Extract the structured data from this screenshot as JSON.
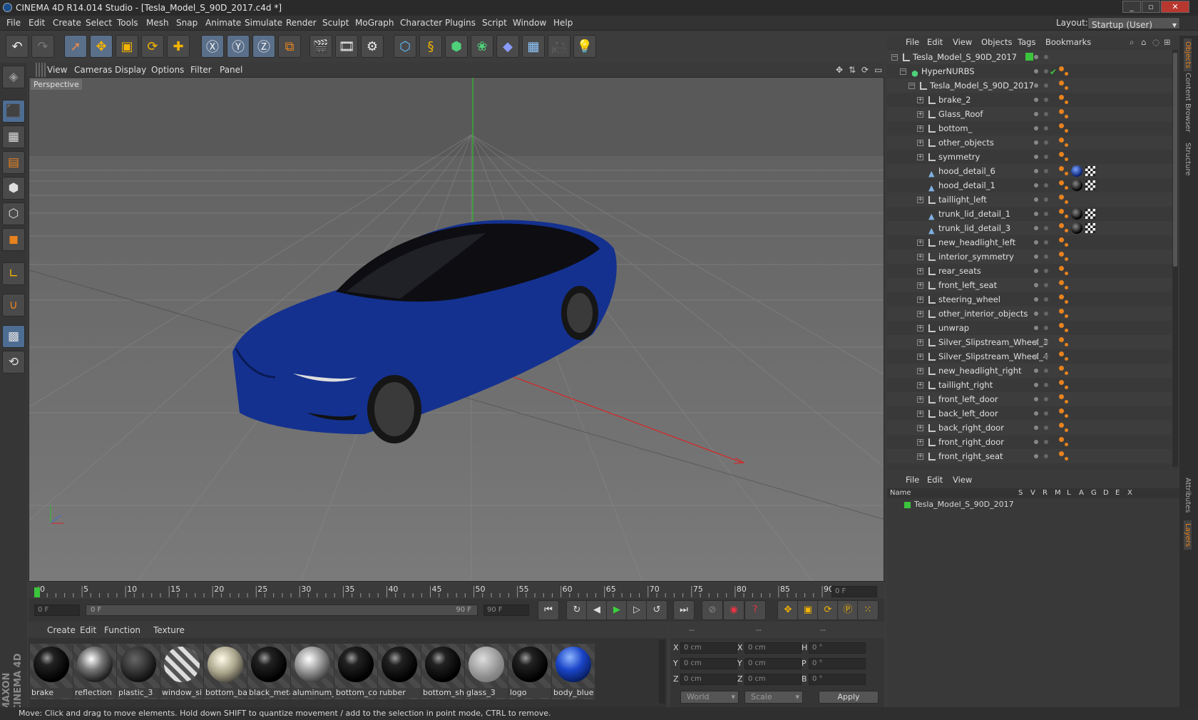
{
  "window": {
    "title": "CINEMA 4D R14.014 Studio - [Tesla_Model_S_90D_2017.c4d *]",
    "layout_label": "Layout:",
    "layout_value": "Startup (User)"
  },
  "menu": [
    "File",
    "Edit",
    "Create",
    "Select",
    "Tools",
    "Mesh",
    "Snap",
    "Animate",
    "Simulate",
    "Render",
    "Sculpt",
    "MoGraph",
    "Character",
    "Plugins",
    "Script",
    "Window",
    "Help"
  ],
  "viewport": {
    "menu": [
      "View",
      "Cameras",
      "Display",
      "Options",
      "Filter",
      "Panel"
    ],
    "label": "Perspective"
  },
  "objects": {
    "menu": [
      "File",
      "Edit",
      "View",
      "Objects",
      "Tags",
      "Bookmarks"
    ],
    "rows": [
      {
        "name": "Tesla_Model_S_90D_2017",
        "indent": 0,
        "type": "null"
      },
      {
        "name": "HyperNURBS",
        "indent": 1,
        "type": "nurbs"
      },
      {
        "name": "Tesla_Model_S_90D_2017",
        "indent": 2,
        "type": "null"
      },
      {
        "name": "brake_2",
        "indent": 3,
        "type": "null"
      },
      {
        "name": "Glass_Roof",
        "indent": 3,
        "type": "null"
      },
      {
        "name": "bottom_",
        "indent": 3,
        "type": "null"
      },
      {
        "name": "other_objects",
        "indent": 3,
        "type": "null"
      },
      {
        "name": "symmetry",
        "indent": 3,
        "type": "null"
      },
      {
        "name": "hood_detail_6",
        "indent": 3,
        "type": "poly",
        "mat": "blue"
      },
      {
        "name": "hood_detail_1",
        "indent": 3,
        "type": "poly",
        "mat": "black"
      },
      {
        "name": "taillight_left",
        "indent": 3,
        "type": "null"
      },
      {
        "name": "trunk_lid_detail_1",
        "indent": 3,
        "type": "poly",
        "mat": "black"
      },
      {
        "name": "trunk_lid_detail_3",
        "indent": 3,
        "type": "poly",
        "mat": "black"
      },
      {
        "name": "new_headlight_left",
        "indent": 3,
        "type": "null"
      },
      {
        "name": "interior_symmetry",
        "indent": 3,
        "type": "null"
      },
      {
        "name": "rear_seats",
        "indent": 3,
        "type": "null"
      },
      {
        "name": "front_left_seat",
        "indent": 3,
        "type": "null"
      },
      {
        "name": "steering_wheel",
        "indent": 3,
        "type": "null"
      },
      {
        "name": "other_interior_objects",
        "indent": 3,
        "type": "null"
      },
      {
        "name": "unwrap",
        "indent": 3,
        "type": "null"
      },
      {
        "name": "Silver_Slipstream_Wheel_3",
        "indent": 3,
        "type": "null"
      },
      {
        "name": "Silver_Slipstream_Wheel_4",
        "indent": 3,
        "type": "null"
      },
      {
        "name": "new_headlight_right",
        "indent": 3,
        "type": "null"
      },
      {
        "name": "taillight_right",
        "indent": 3,
        "type": "null"
      },
      {
        "name": "front_left_door",
        "indent": 3,
        "type": "null"
      },
      {
        "name": "back_left_door",
        "indent": 3,
        "type": "null"
      },
      {
        "name": "back_right_door",
        "indent": 3,
        "type": "null"
      },
      {
        "name": "front_right_door",
        "indent": 3,
        "type": "null"
      },
      {
        "name": "front_right_seat",
        "indent": 3,
        "type": "null"
      }
    ]
  },
  "layers": {
    "menu": [
      "File",
      "Edit",
      "View"
    ],
    "name_header": "Name",
    "cols": [
      "S",
      "V",
      "R",
      "M",
      "L",
      "A",
      "G",
      "D",
      "E",
      "X"
    ],
    "row": "Tesla_Model_S_90D_2017"
  },
  "right_tabs": [
    "Objects",
    "Content Browser",
    "Structure",
    "Attributes",
    "Layers"
  ],
  "timeline": {
    "ticks": [
      "0",
      "5",
      "10",
      "15",
      "20",
      "25",
      "30",
      "35",
      "40",
      "45",
      "50",
      "55",
      "60",
      "65",
      "70",
      "75",
      "80",
      "85",
      "90"
    ],
    "frame_field": "0 F",
    "current": "0 F",
    "range_start": "0 F",
    "range_end": "90 F",
    "end_field": "90 F"
  },
  "materials": {
    "menu": [
      "Create",
      "Edit",
      "Function",
      "Texture"
    ],
    "items": [
      {
        "name": "brake",
        "style": "black"
      },
      {
        "name": "reflection",
        "style": "chrome"
      },
      {
        "name": "plastic_3",
        "style": "darkgray"
      },
      {
        "name": "window_si",
        "style": "stripe"
      },
      {
        "name": "bottom_ba",
        "style": "ivory"
      },
      {
        "name": "black_meta",
        "style": "black"
      },
      {
        "name": "aluminum_",
        "style": "silver"
      },
      {
        "name": "bottom_co",
        "style": "black"
      },
      {
        "name": "rubber",
        "style": "black"
      },
      {
        "name": "bottom_sh",
        "style": "black"
      },
      {
        "name": "glass_3",
        "style": "glass"
      },
      {
        "name": "logo",
        "style": "black"
      },
      {
        "name": "body_blue",
        "style": "blue"
      }
    ]
  },
  "coords": {
    "headers": [
      "--",
      "--",
      "--"
    ],
    "rows": [
      {
        "a": "X",
        "av": "0 cm",
        "b": "X",
        "bv": "0 cm",
        "c": "H",
        "cv": "0 °"
      },
      {
        "a": "Y",
        "av": "0 cm",
        "b": "Y",
        "bv": "0 cm",
        "c": "P",
        "cv": "0 °"
      },
      {
        "a": "Z",
        "av": "0 cm",
        "b": "Z",
        "bv": "0 cm",
        "c": "B",
        "cv": "0 °"
      }
    ],
    "mode": "World",
    "scale": "Scale",
    "apply": "Apply"
  },
  "status": "Move: Click and drag to move elements. Hold down SHIFT to quantize movement / add to the selection in point mode, CTRL to remove.",
  "brand": "MAXON CINEMA 4D",
  "colors": {
    "accent": "#e8821e",
    "blue_car": "#14318f",
    "green": "#3cc43c"
  }
}
